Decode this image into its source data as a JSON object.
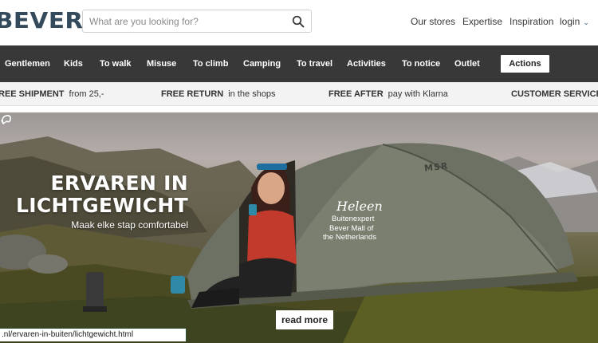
{
  "header": {
    "logo_text": "BEVER",
    "search_placeholder": "What are you looking for?",
    "links": [
      "Our stores",
      "Expertise",
      "Inspiration"
    ],
    "login_label": "login",
    "brand_color": "#33495c"
  },
  "nav": {
    "items": [
      "Gentlemen",
      "Kids",
      "To walk",
      "Misuse",
      "To climb",
      "Camping",
      "To travel",
      "Activities",
      "To notice",
      "Outlet"
    ],
    "actions_label": "Actions",
    "background": "#383838"
  },
  "usp": [
    {
      "strong": "REE SHIPMENT",
      "text": "from 25,-"
    },
    {
      "strong": "FREE RETURN",
      "text": "in the shops"
    },
    {
      "strong": "FREE AFTER",
      "text": "pay with Klarna"
    },
    {
      "strong": "CUSTOMER SERVICE",
      "text": ""
    }
  ],
  "hero": {
    "title_line1": "ERVAREN IN",
    "title_line2": "LICHTGEWICHT",
    "subtitle": "Maak elke stap comfortabel",
    "person_name": "Heleen",
    "person_role_line1": "Buitenexpert",
    "person_role_line2": "Bever Mall of",
    "person_role_line3": "the Netherlands",
    "tent_brand": "MSR",
    "read_more_label": "read more"
  },
  "status_bar": {
    "url": ".nl/ervaren-in-buiten/lichtgewicht.html"
  }
}
